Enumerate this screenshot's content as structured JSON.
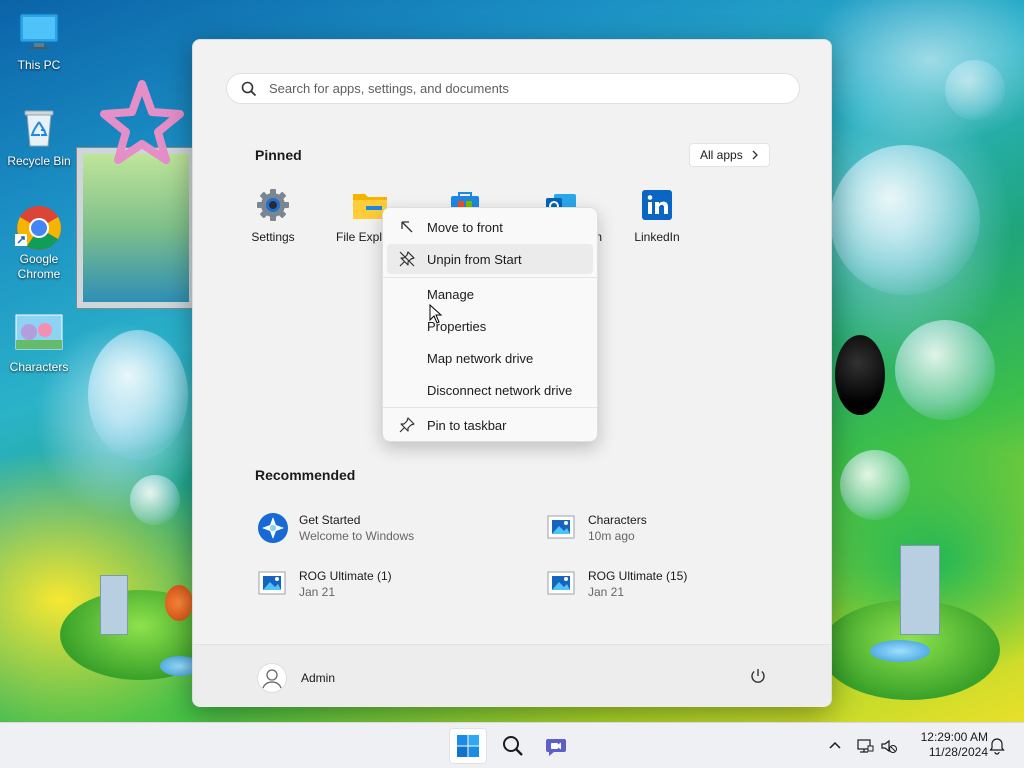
{
  "desktop": {
    "icons": [
      {
        "label": "This PC"
      },
      {
        "label": "Recycle Bin"
      },
      {
        "label": "Google Chrome"
      },
      {
        "label": "Characters"
      }
    ]
  },
  "start": {
    "search": {
      "placeholder": "Search for apps, settings, and documents"
    },
    "pinned_title": "Pinned",
    "all_apps_label": "All apps",
    "pinned": [
      {
        "label": "Settings",
        "icon": "settings-icon"
      },
      {
        "label": "File Explo",
        "icon": "file-explorer-icon"
      },
      {
        "label": "",
        "icon": "microsoft-store-icon"
      },
      {
        "label": "n",
        "icon": "outlook-icon"
      },
      {
        "label": "LinkedIn",
        "icon": "linkedin-icon"
      }
    ],
    "recommended_title": "Recommended",
    "recommended": [
      {
        "title": "Get Started",
        "subtitle": "Welcome to Windows",
        "icon": "get-started-icon"
      },
      {
        "title": "Characters",
        "subtitle": "10m ago",
        "icon": "image-file-icon"
      },
      {
        "title": "ROG Ultimate (1)",
        "subtitle": "Jan 21",
        "icon": "image-file-icon"
      },
      {
        "title": "ROG Ultimate (15)",
        "subtitle": "Jan 21",
        "icon": "image-file-icon"
      }
    ],
    "user_name": "Admin"
  },
  "context_menu": {
    "items": [
      {
        "label": "Move to front",
        "icon": "arrow-up-left-icon"
      },
      {
        "label": "Unpin from Start",
        "icon": "unpin-icon"
      },
      {
        "label": "Manage",
        "icon": ""
      },
      {
        "label": "Properties",
        "icon": ""
      },
      {
        "label": "Map network drive",
        "icon": ""
      },
      {
        "label": "Disconnect network drive",
        "icon": ""
      },
      {
        "label": "Pin to taskbar",
        "icon": "pin-icon"
      }
    ]
  },
  "taskbar": {
    "time": "12:29:00 AM",
    "date": "11/28/2024"
  },
  "colors": {
    "accent": "#0067c0",
    "linkedin": "#0a66c2",
    "menu_bg": "#f2f2f2"
  }
}
